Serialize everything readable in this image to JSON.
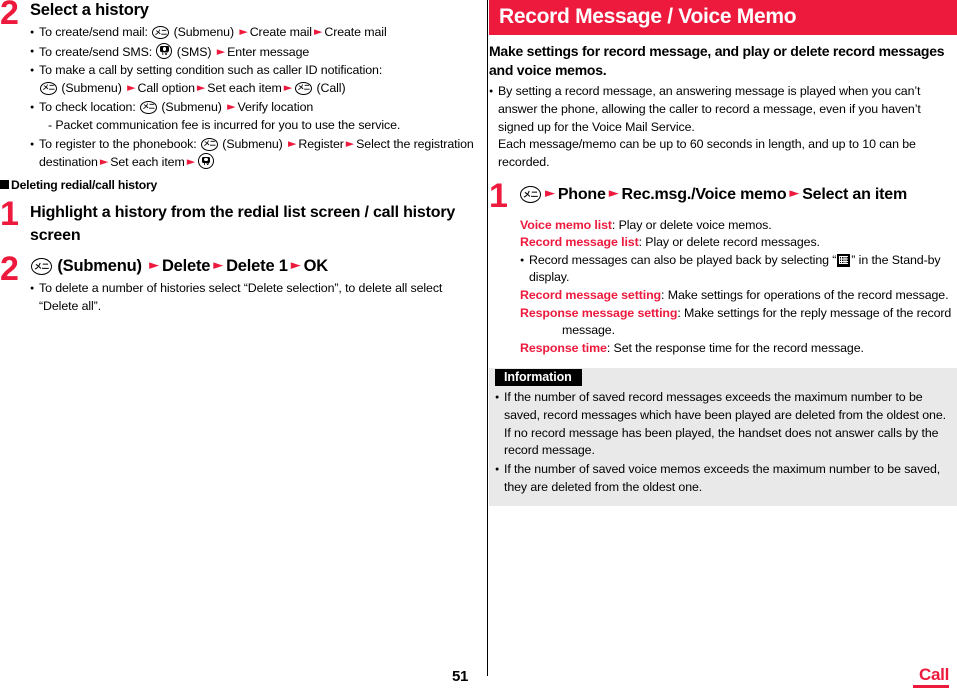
{
  "document": {
    "page_number": "51",
    "footer_tab": "Call",
    "accent_color": "#ED1A3D"
  },
  "left_column": {
    "step2": {
      "number": "2",
      "title": "Select a history",
      "bullets": [
        {
          "id": "create-send-mail",
          "prefix": "To create/send mail: ",
          "icon": "submenu-key-icon",
          "icon_glyph": "メニュ",
          "after_icon": " (Submenu) ",
          "steps": [
            "Create mail",
            "Create mail"
          ]
        },
        {
          "id": "create-send-sms",
          "prefix": "To create/send SMS: ",
          "icon": "camera-tv-key-icon",
          "after_icon": " (SMS) ",
          "steps": [
            "Enter message"
          ]
        },
        {
          "id": "make-call-condition",
          "line1": "To make a call by setting condition such as caller ID notification:",
          "icon": "submenu-key-icon",
          "after_icon": " (Submenu) ",
          "steps": [
            "Call option",
            "Set each item"
          ],
          "tail_icon": "submenu-key-icon",
          "tail_text": " (Call)"
        },
        {
          "id": "check-location",
          "prefix": "To check location: ",
          "icon": "submenu-key-icon",
          "after_icon": " (Submenu) ",
          "steps": [
            "Verify location"
          ],
          "sub": "- Packet communication fee is incurred for you to use the service."
        },
        {
          "id": "register-phonebook",
          "prefix": "To register to the phonebook: ",
          "icon": "submenu-key-icon",
          "after_icon": " (Submenu) ",
          "steps": [
            "Register",
            "Select the registration destination",
            "Set each item"
          ],
          "tail_icon": "camera-tv-key-icon"
        }
      ]
    },
    "subheading": "Deleting redial/call history",
    "step1": {
      "number": "1",
      "title": "Highlight a history from the redial list screen / call history screen"
    },
    "step2b": {
      "number": "2",
      "icon": "submenu-key-icon",
      "lead": " (Submenu) ",
      "steps": [
        "Delete",
        "Delete 1",
        "OK"
      ],
      "bullets": [
        "To delete a number of histories select “Delete selection”, to delete all select “Delete all”."
      ]
    }
  },
  "right_column": {
    "section_title": "Record Message / Voice Memo",
    "lead": "Make settings for record message, and play or delete record messages and voice memos.",
    "lead_bullets": [
      {
        "text": "By setting a record message, an answering message is played when you can’t answer the phone, allowing the caller to record a message, even if you haven’t signed up for the Voice Mail Service.",
        "cont": "Each message/memo can be up to 60 seconds in length, and up to 10 can be recorded."
      }
    ],
    "step1": {
      "number": "1",
      "icon": "submenu-key-icon",
      "steps": [
        "Phone",
        "Rec.msg./Voice memo",
        "Select an item"
      ]
    },
    "options": [
      {
        "name": "Voice memo list",
        "desc": ": Play or delete voice memos."
      },
      {
        "name": "Record message list",
        "desc": ": Play or delete record messages."
      },
      {
        "name": "Record message setting",
        "desc": ": Make settings for operations of the record message."
      },
      {
        "name": "Response message setting",
        "desc": ": Make settings for the reply message of the record message."
      },
      {
        "name": "Response time",
        "desc": ": Set the response time for the record message."
      }
    ],
    "option_note": {
      "before_icon": "Record messages can also be played back by selecting “",
      "icon": "standby-grid-icon",
      "after_icon": "” in the Stand-by display."
    },
    "information": {
      "title": "Information",
      "items": [
        "If the number of saved record messages exceeds the maximum number to be saved, record messages which have been played are deleted from the oldest one. If no record message has been played, the handset does not answer calls by the record message.",
        "If the number of saved voice memos exceeds the maximum number to be saved, they are deleted from the oldest one."
      ]
    }
  }
}
